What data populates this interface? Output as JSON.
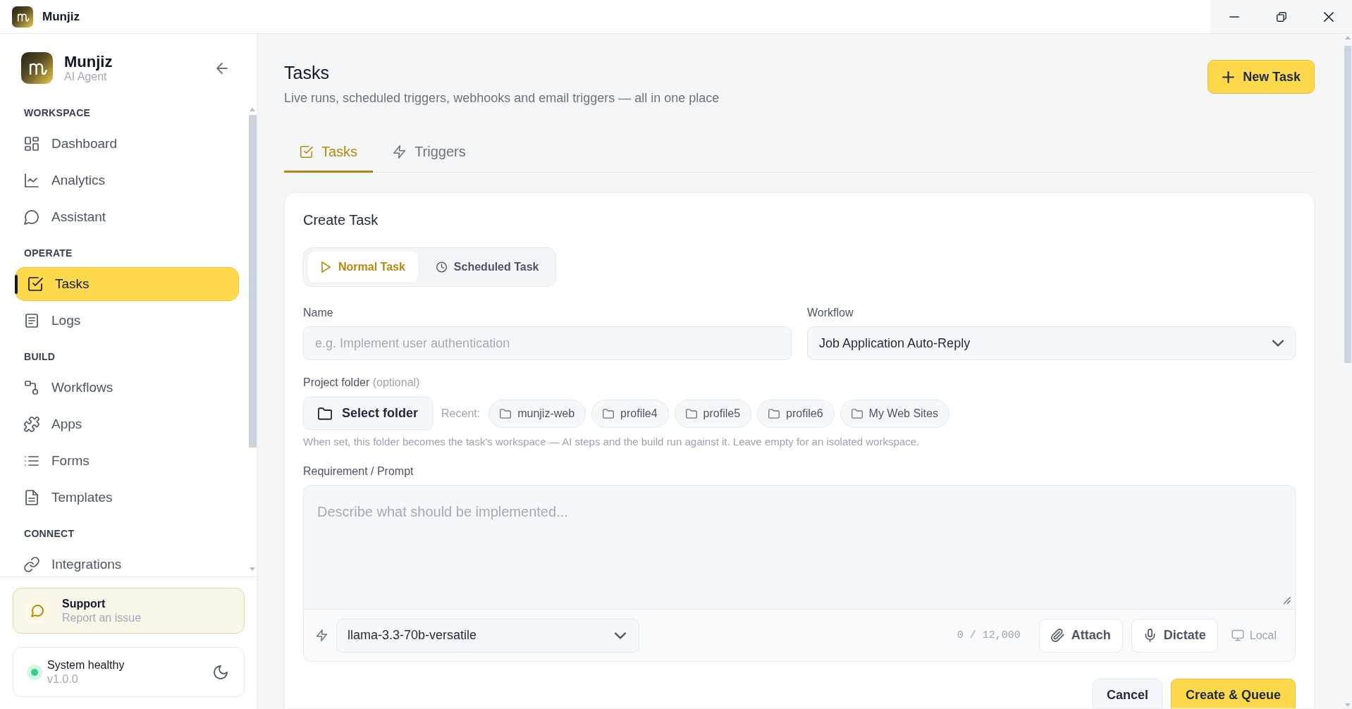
{
  "window": {
    "title": "Munjiz"
  },
  "sidebar": {
    "brand": {
      "name": "Munjiz",
      "tagline": "AI Agent"
    },
    "sections": [
      {
        "label": "WORKSPACE",
        "items": [
          {
            "label": "Dashboard",
            "selected": false
          },
          {
            "label": "Analytics",
            "selected": false
          },
          {
            "label": "Assistant",
            "selected": false
          }
        ]
      },
      {
        "label": "OPERATE",
        "items": [
          {
            "label": "Tasks",
            "selected": true
          },
          {
            "label": "Logs",
            "selected": false
          }
        ]
      },
      {
        "label": "BUILD",
        "items": [
          {
            "label": "Workflows",
            "selected": false
          },
          {
            "label": "Apps",
            "selected": false
          },
          {
            "label": "Forms",
            "selected": false
          },
          {
            "label": "Templates",
            "selected": false
          }
        ]
      },
      {
        "label": "CONNECT",
        "items": [
          {
            "label": "Integrations",
            "selected": false
          }
        ]
      }
    ],
    "support": {
      "title": "Support",
      "subtitle": "Report an issue"
    },
    "status": {
      "label": "System healthy",
      "version": "v1.0.0",
      "healthy": true
    }
  },
  "page": {
    "title": "Tasks",
    "subtitle": "Live runs, scheduled triggers, webhooks and email triggers — all in one place",
    "new_button": "New Task"
  },
  "tabs": [
    {
      "label": "Tasks",
      "selected": true
    },
    {
      "label": "Triggers",
      "selected": false
    }
  ],
  "create_task": {
    "title": "Create Task",
    "types": [
      {
        "label": "Normal Task",
        "selected": true
      },
      {
        "label": "Scheduled Task",
        "selected": false
      }
    ],
    "name": {
      "label": "Name",
      "placeholder": "e.g. Implement user authentication"
    },
    "workflow": {
      "label": "Workflow",
      "value": "Job Application Auto-Reply"
    },
    "project_folder": {
      "label": "Project folder",
      "note": "(optional)",
      "button": "Select folder",
      "recent_label": "Recent:",
      "recent": [
        "munjiz-web",
        "profile4",
        "profile5",
        "profile6",
        "My Web Sites"
      ],
      "help": "When set, this folder becomes the task's workspace — AI steps and the build run against it. Leave empty for an isolated workspace."
    },
    "prompt": {
      "label": "Requirement / Prompt",
      "placeholder": "Describe what should be implemented...",
      "model": "llama-3.3-70b-versatile",
      "counter": "0 / 12,000",
      "actions": [
        {
          "label": "Attach",
          "kind": "button"
        },
        {
          "label": "Dictate",
          "kind": "button"
        },
        {
          "label": "Local",
          "kind": "plain"
        }
      ]
    },
    "buttons": [
      {
        "label": "Cancel",
        "kind": "secondary"
      },
      {
        "label": "Create & Queue",
        "kind": "primary"
      }
    ]
  }
}
